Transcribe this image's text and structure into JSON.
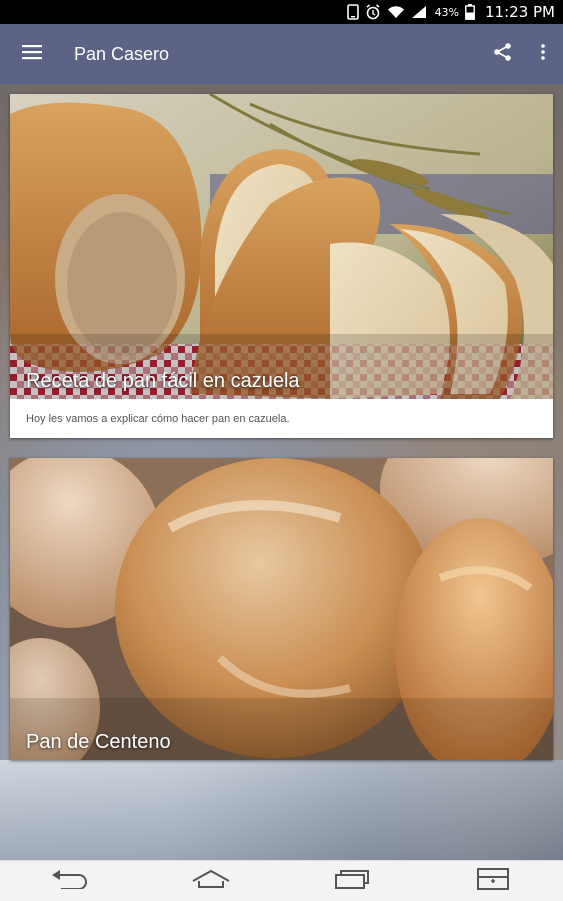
{
  "status_bar": {
    "battery_percent": "43%",
    "time": "11:23 PM"
  },
  "app_bar": {
    "title": "Pan Casero"
  },
  "cards": [
    {
      "title": "Receta de pan fácil en cazuela",
      "description": "Hoy les vamos a explicar cómo hacer pan en cazuela."
    },
    {
      "title": "Pan de Centeno",
      "description": ""
    }
  ],
  "colors": {
    "app_bar": "#5c6385",
    "status_bar": "#000000",
    "nav_bar": "#f3f3f3"
  }
}
